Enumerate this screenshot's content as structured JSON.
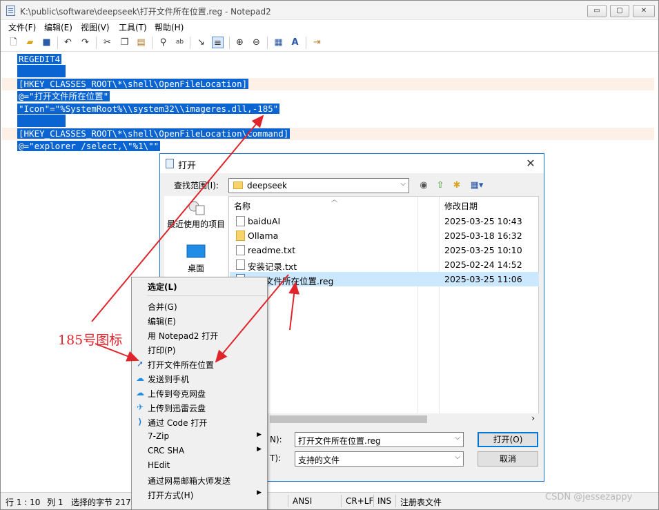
{
  "window": {
    "title": "K:\\public\\software\\deepseek\\打开文件所在位置.reg - Notepad2",
    "controls": {
      "minimize": "▭",
      "maximize": "▢",
      "close": "✕"
    }
  },
  "menu": [
    "文件(F)",
    "编辑(E)",
    "视图(V)",
    "工具(T)",
    "帮助(H)"
  ],
  "toolbar_icons": [
    "new-icon",
    "open-icon",
    "save-icon",
    "undo-icon",
    "redo-icon",
    "cut-icon",
    "copy-icon",
    "paste-icon",
    "find-icon",
    "replace-icon",
    "goto-icon",
    "wordwrap-icon",
    "zoom-in-icon",
    "zoom-out-icon",
    "settings-icon",
    "font-icon",
    "exit-icon"
  ],
  "editor": {
    "lines": [
      "REGEDIT4",
      "",
      "[HKEY_CLASSES_ROOT\\*\\shell\\OpenFileLocation]",
      "@=\"打开文件所在位置\"",
      "\"Icon\"=\"%SystemRoot%\\\\system32\\\\imageres.dll,-185\"",
      "",
      "[HKEY_CLASSES_ROOT\\*\\shell\\OpenFileLocation\\command]",
      "@=\"explorer /select,\\\"%1\\\"\""
    ]
  },
  "status": {
    "position": "行 1 : 10",
    "column": "列 1",
    "selected": "选择的字节 217",
    "encoding": "ANSI",
    "eol": "CR+LF",
    "mode": "INS",
    "lexer": "注册表文件"
  },
  "dialog": {
    "title": "打开",
    "lookin_label": "查找范围(I):",
    "lookin_value": "deepseek",
    "places": [
      {
        "label": "最近使用的项目",
        "icon": "recent-items-icon"
      },
      {
        "label": "桌面",
        "icon": "desktop-icon"
      }
    ],
    "columns": {
      "name": "名称",
      "date": "修改日期"
    },
    "files": [
      {
        "name": "baiduAI",
        "date": "2025-03-25 10:43",
        "icon": "shortcut-icon"
      },
      {
        "name": "Ollama",
        "date": "2025-03-18 16:32",
        "icon": "folder-shortcut-icon"
      },
      {
        "name": "readme.txt",
        "date": "2025-03-25 10:10",
        "icon": "text-file-icon"
      },
      {
        "name": "安装记录.txt",
        "date": "2025-02-24 14:52",
        "icon": "text-file-icon"
      },
      {
        "name": "打开文件所在位置.reg",
        "date": "2025-03-25 11:06",
        "icon": "reg-file-icon",
        "selected": true
      }
    ],
    "filename_label": "N):",
    "filename_value": "打开文件所在位置.reg",
    "filetype_label": "T):",
    "filetype_value": "支持的文件",
    "open_button": "打开(O)",
    "cancel_button": "取消"
  },
  "context_menu": [
    {
      "label": "选定(L)",
      "default": true
    },
    {
      "separator": true
    },
    {
      "label": "合并(G)"
    },
    {
      "label": "编辑(E)"
    },
    {
      "label": "用 Notepad2 打开"
    },
    {
      "label": "打印(P)"
    },
    {
      "label": "打开文件所在位置",
      "icon": "open-location-icon"
    },
    {
      "label": "发送到手机",
      "icon": "cloud-phone-icon"
    },
    {
      "label": "上传到夸克网盘",
      "icon": "quark-cloud-icon"
    },
    {
      "label": "上传到迅雷云盘",
      "icon": "xunlei-cloud-icon"
    },
    {
      "label": "通过 Code 打开",
      "icon": "vscode-icon"
    },
    {
      "label": "7-Zip",
      "submenu": true
    },
    {
      "label": "CRC SHA",
      "submenu": true
    },
    {
      "label": "HEdit"
    },
    {
      "label": "通过网易邮箱大师发送"
    },
    {
      "label": "打开方式(H)",
      "submenu": true
    }
  ],
  "annotation": {
    "text": "185号图标",
    "color": "#e0242b"
  },
  "watermark": "CSDN @jessezappy",
  "colors": {
    "selection": "#0a64d2",
    "current_line": "#fdf0e6",
    "dialog_border": "#1c79d4",
    "selected_row": "#cce8ff"
  }
}
